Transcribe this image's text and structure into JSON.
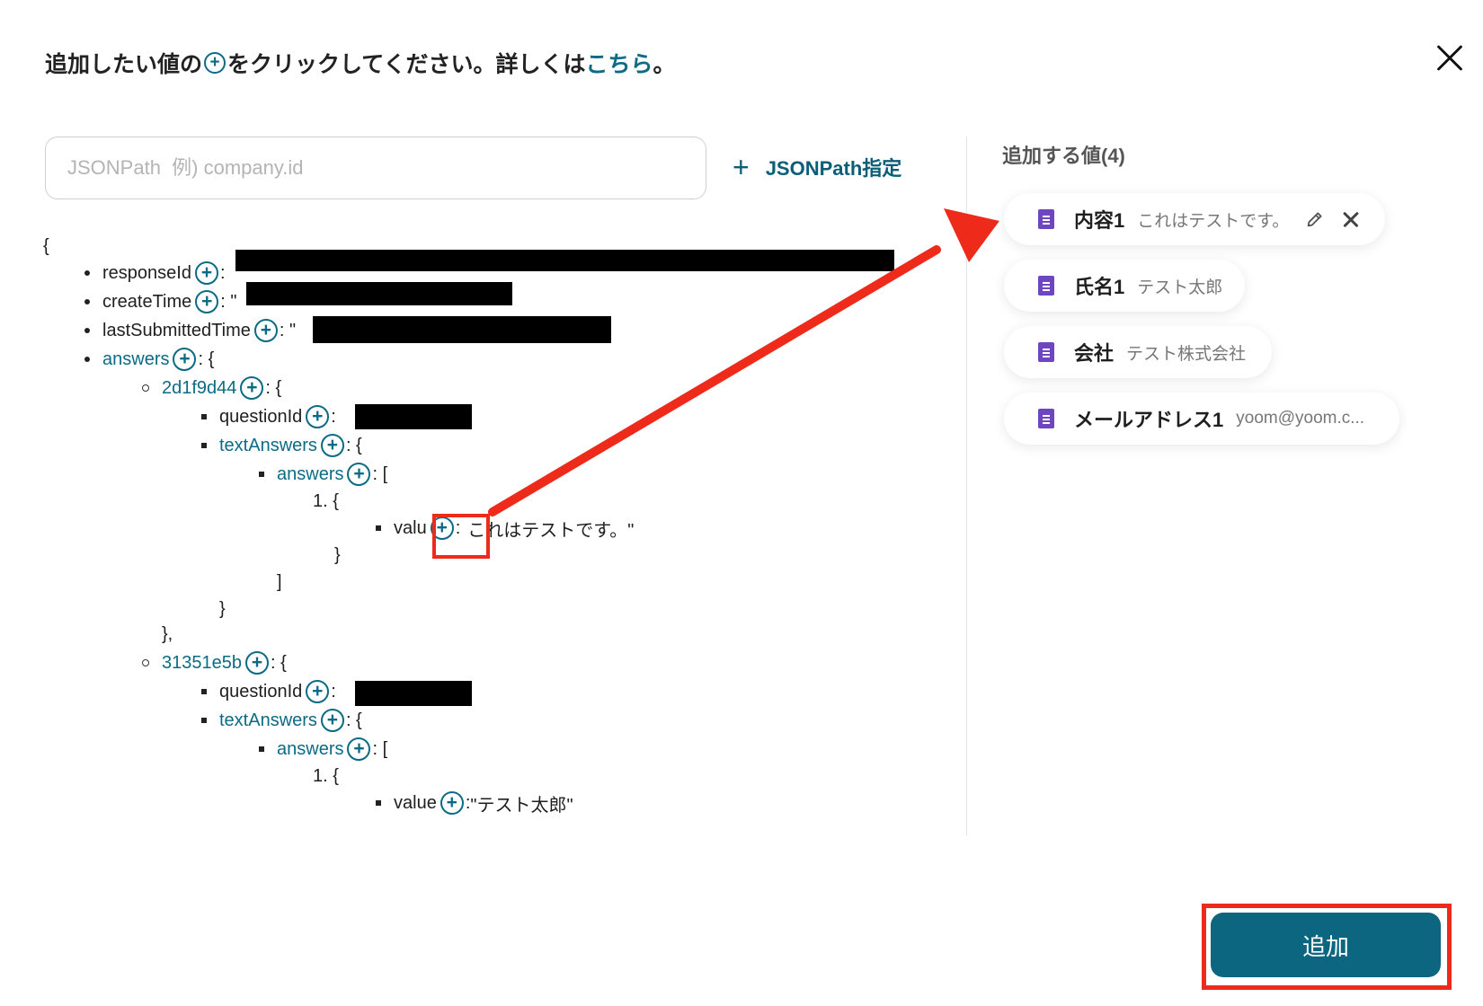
{
  "header": {
    "text_before": "追加したい値の",
    "text_after": "をクリックしてください。詳しくは",
    "link": "こちら",
    "text_end": "。"
  },
  "search": {
    "placeholder": "JSONPath  例) company.id"
  },
  "jsonpath_button": {
    "label": "JSONPath指定"
  },
  "tree": {
    "open_brace": "{",
    "responseId": {
      "key": "responseId",
      "sep": ":"
    },
    "createTime": {
      "key": "createTime",
      "sep": ": \""
    },
    "lastSubmittedTime": {
      "key": "lastSubmittedTime",
      "sep": ": \""
    },
    "answers": {
      "key": "answers",
      "sep": ": {"
    },
    "groups": [
      {
        "key": "2d1f9d44",
        "sep": ": {",
        "questionId": "questionId",
        "qsep": ":",
        "textAnswers": "textAnswers",
        "tsep": ": {",
        "answers": "answers",
        "asep": ": [",
        "item_open": "1. {",
        "value_key": "valu",
        "value_sep": ":",
        "value": "これはテストです。\"",
        "item_close": "}",
        "array_close": "]",
        "obj_close": "}",
        "group_close": "},"
      },
      {
        "key": "31351e5b",
        "sep": ": {",
        "questionId": "questionId",
        "qsep": ":",
        "textAnswers": "textAnswers",
        "tsep": ": {",
        "answers": "answers",
        "asep": ": [",
        "item_open": "1. {",
        "value_key": "value",
        "value_sep": ": ",
        "value": "\"テスト太郎\""
      }
    ]
  },
  "right_panel": {
    "title": "追加する値(4)",
    "chips": [
      {
        "name": "内容1",
        "value": "これはテストです。",
        "icon": "doc-icon"
      },
      {
        "name": "氏名1",
        "value": "テスト太郎",
        "icon": "doc-icon"
      },
      {
        "name": "会社",
        "value": "テスト株式会社",
        "icon": "doc-icon"
      },
      {
        "name": "メールアドレス1",
        "value": "yoom@yoom.c...",
        "icon": "doc-icon"
      }
    ]
  },
  "add_button": {
    "label": "追加"
  },
  "colors": {
    "accent": "#0b6b85",
    "button": "#0d6680",
    "highlight": "#ee2a1b",
    "doc_icon": "#6e46c2"
  }
}
